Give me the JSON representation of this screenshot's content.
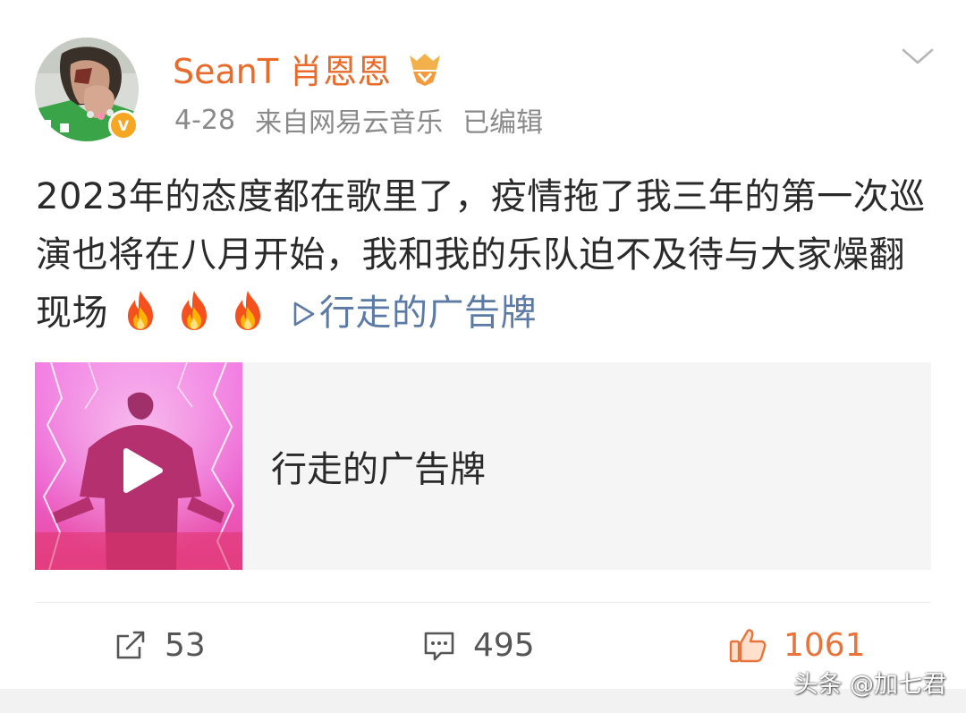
{
  "header": {
    "username": "SeanT 肖恩恩",
    "timestamp": "4-28",
    "source": "来自网易云音乐",
    "edited": "已编辑",
    "verified_badge": "V",
    "username_color": "#e86b2b"
  },
  "post": {
    "text": "2023年的态度都在歌里了，疫情拖了我三年的第一次巡演也将在八月开始，我和我的乐队迫不及待与大家燥翻现场",
    "emoji_icons": [
      "fire-icon",
      "fire-icon",
      "fire-icon"
    ],
    "song_link": "行走的广告牌",
    "link_color": "#5b7aa6"
  },
  "music_card": {
    "title": "行走的广告牌"
  },
  "actions": {
    "repost_count": "53",
    "comment_count": "495",
    "like_count": "1061",
    "like_color": "#e8743b"
  },
  "watermark": "头条 @加七君"
}
